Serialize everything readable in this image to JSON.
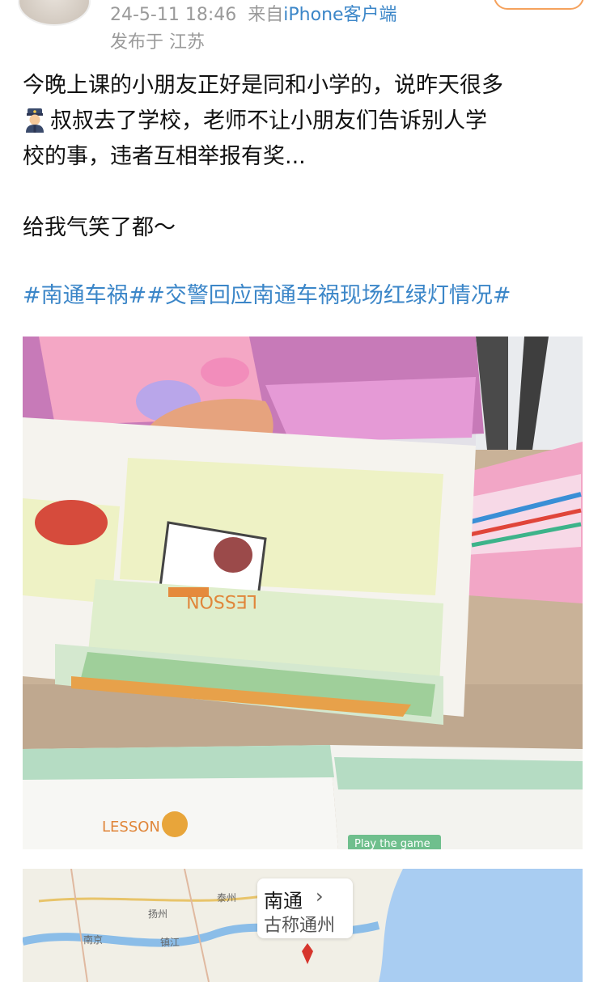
{
  "post": {
    "timestamp": "24-5-11 18:46",
    "source_prefix": "来自",
    "source_client": "iPhone客户端",
    "location": "发布于 江苏",
    "text_line1": "今晚上课的小朋友正好是同和小学的，说昨天很多",
    "text_line2": "叔叔去了学校，老师不让小朋友们告诉别人学",
    "text_line3": "校的事，违者互相举报有奖...",
    "text_line4": "给我气笑了都～",
    "emoji": "police-officer-icon",
    "hashtags": "#南通车祸##交警回应南通车祸现场红绿灯情况#"
  },
  "photo": {
    "book_text_lesson": "LESSON",
    "book_text_play": "Play the game"
  },
  "map": {
    "city": "南通",
    "old_name": "古称通州",
    "labels": [
      "扬州",
      "泰州",
      "南京",
      "镇江",
      "南通"
    ]
  },
  "colors": {
    "link": "#3b86c8",
    "meta": "#9a9a9a",
    "accent": "#f5a25d"
  }
}
